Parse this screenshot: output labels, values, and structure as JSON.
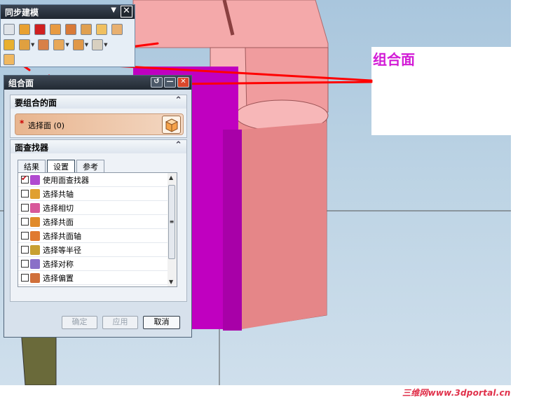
{
  "toolbar": {
    "title": "同步建模",
    "menu_glyph": "▼",
    "close_glyph": "✕"
  },
  "dialog": {
    "title": "组合面",
    "faces_section": {
      "title": "要组合的面",
      "select_label": "选择面 (0)",
      "required_marker": "*"
    },
    "finder_section": {
      "title": "面查找器",
      "tabs": [
        "结果",
        "设置",
        "参考"
      ],
      "active_tab": "设置",
      "items": [
        {
          "label": "使用面查找器",
          "checked": true,
          "icon_color": "#b04ad0"
        },
        {
          "label": "选择共轴",
          "checked": false,
          "icon_color": "#e0a030"
        },
        {
          "label": "选择相切",
          "checked": false,
          "icon_color": "#d8589a"
        },
        {
          "label": "选择共面",
          "checked": false,
          "icon_color": "#e08a2a"
        },
        {
          "label": "选择共面轴",
          "checked": false,
          "icon_color": "#e07a30"
        },
        {
          "label": "选择等半径",
          "checked": false,
          "icon_color": "#c8a032"
        },
        {
          "label": "选择对称",
          "checked": false,
          "icon_color": "#8a70c8"
        },
        {
          "label": "选择偏置",
          "checked": false,
          "icon_color": "#d0703a"
        }
      ]
    },
    "buttons": {
      "ok": "确定",
      "apply": "应用",
      "cancel": "取消"
    }
  },
  "callout": {
    "label": "组合面",
    "color": "#d21ad6"
  },
  "watermark": "三维网www.3dportal.cn",
  "colors": {
    "model_pink": "#f4a7a8",
    "model_selected": "#c000c0",
    "arrow_red": "#ff0000",
    "background_sky": "#b8cfe2"
  }
}
